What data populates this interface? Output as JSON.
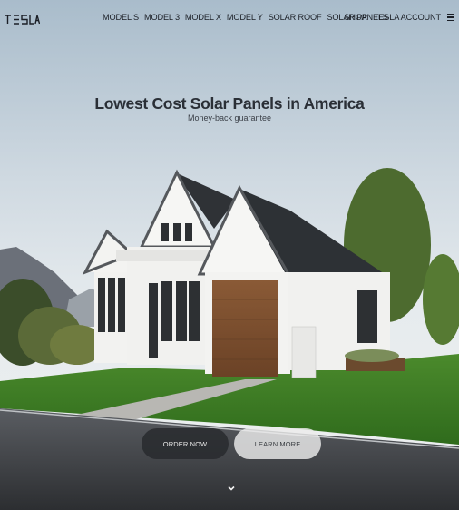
{
  "brand": {
    "logo_text": "TESLA"
  },
  "nav": {
    "links": [
      "MODEL S",
      "MODEL 3",
      "MODEL X",
      "MODEL Y",
      "SOLAR ROOF",
      "SOLAR PANELS"
    ],
    "right_links": [
      "SHOP",
      "TESLA ACCOUNT"
    ],
    "menu_icon": "hamburger-icon"
  },
  "hero": {
    "title": "Lowest Cost Solar Panels in America",
    "subtitle": "Money-back guarantee"
  },
  "actions": {
    "order_label": "ORDER NOW",
    "learn_label": "LEARN MORE"
  },
  "scroll_icon": "chevron-down-icon",
  "colors": {
    "dark_button": "#2a2c30",
    "light_button": "#ebebeb",
    "text": "#171a20"
  }
}
